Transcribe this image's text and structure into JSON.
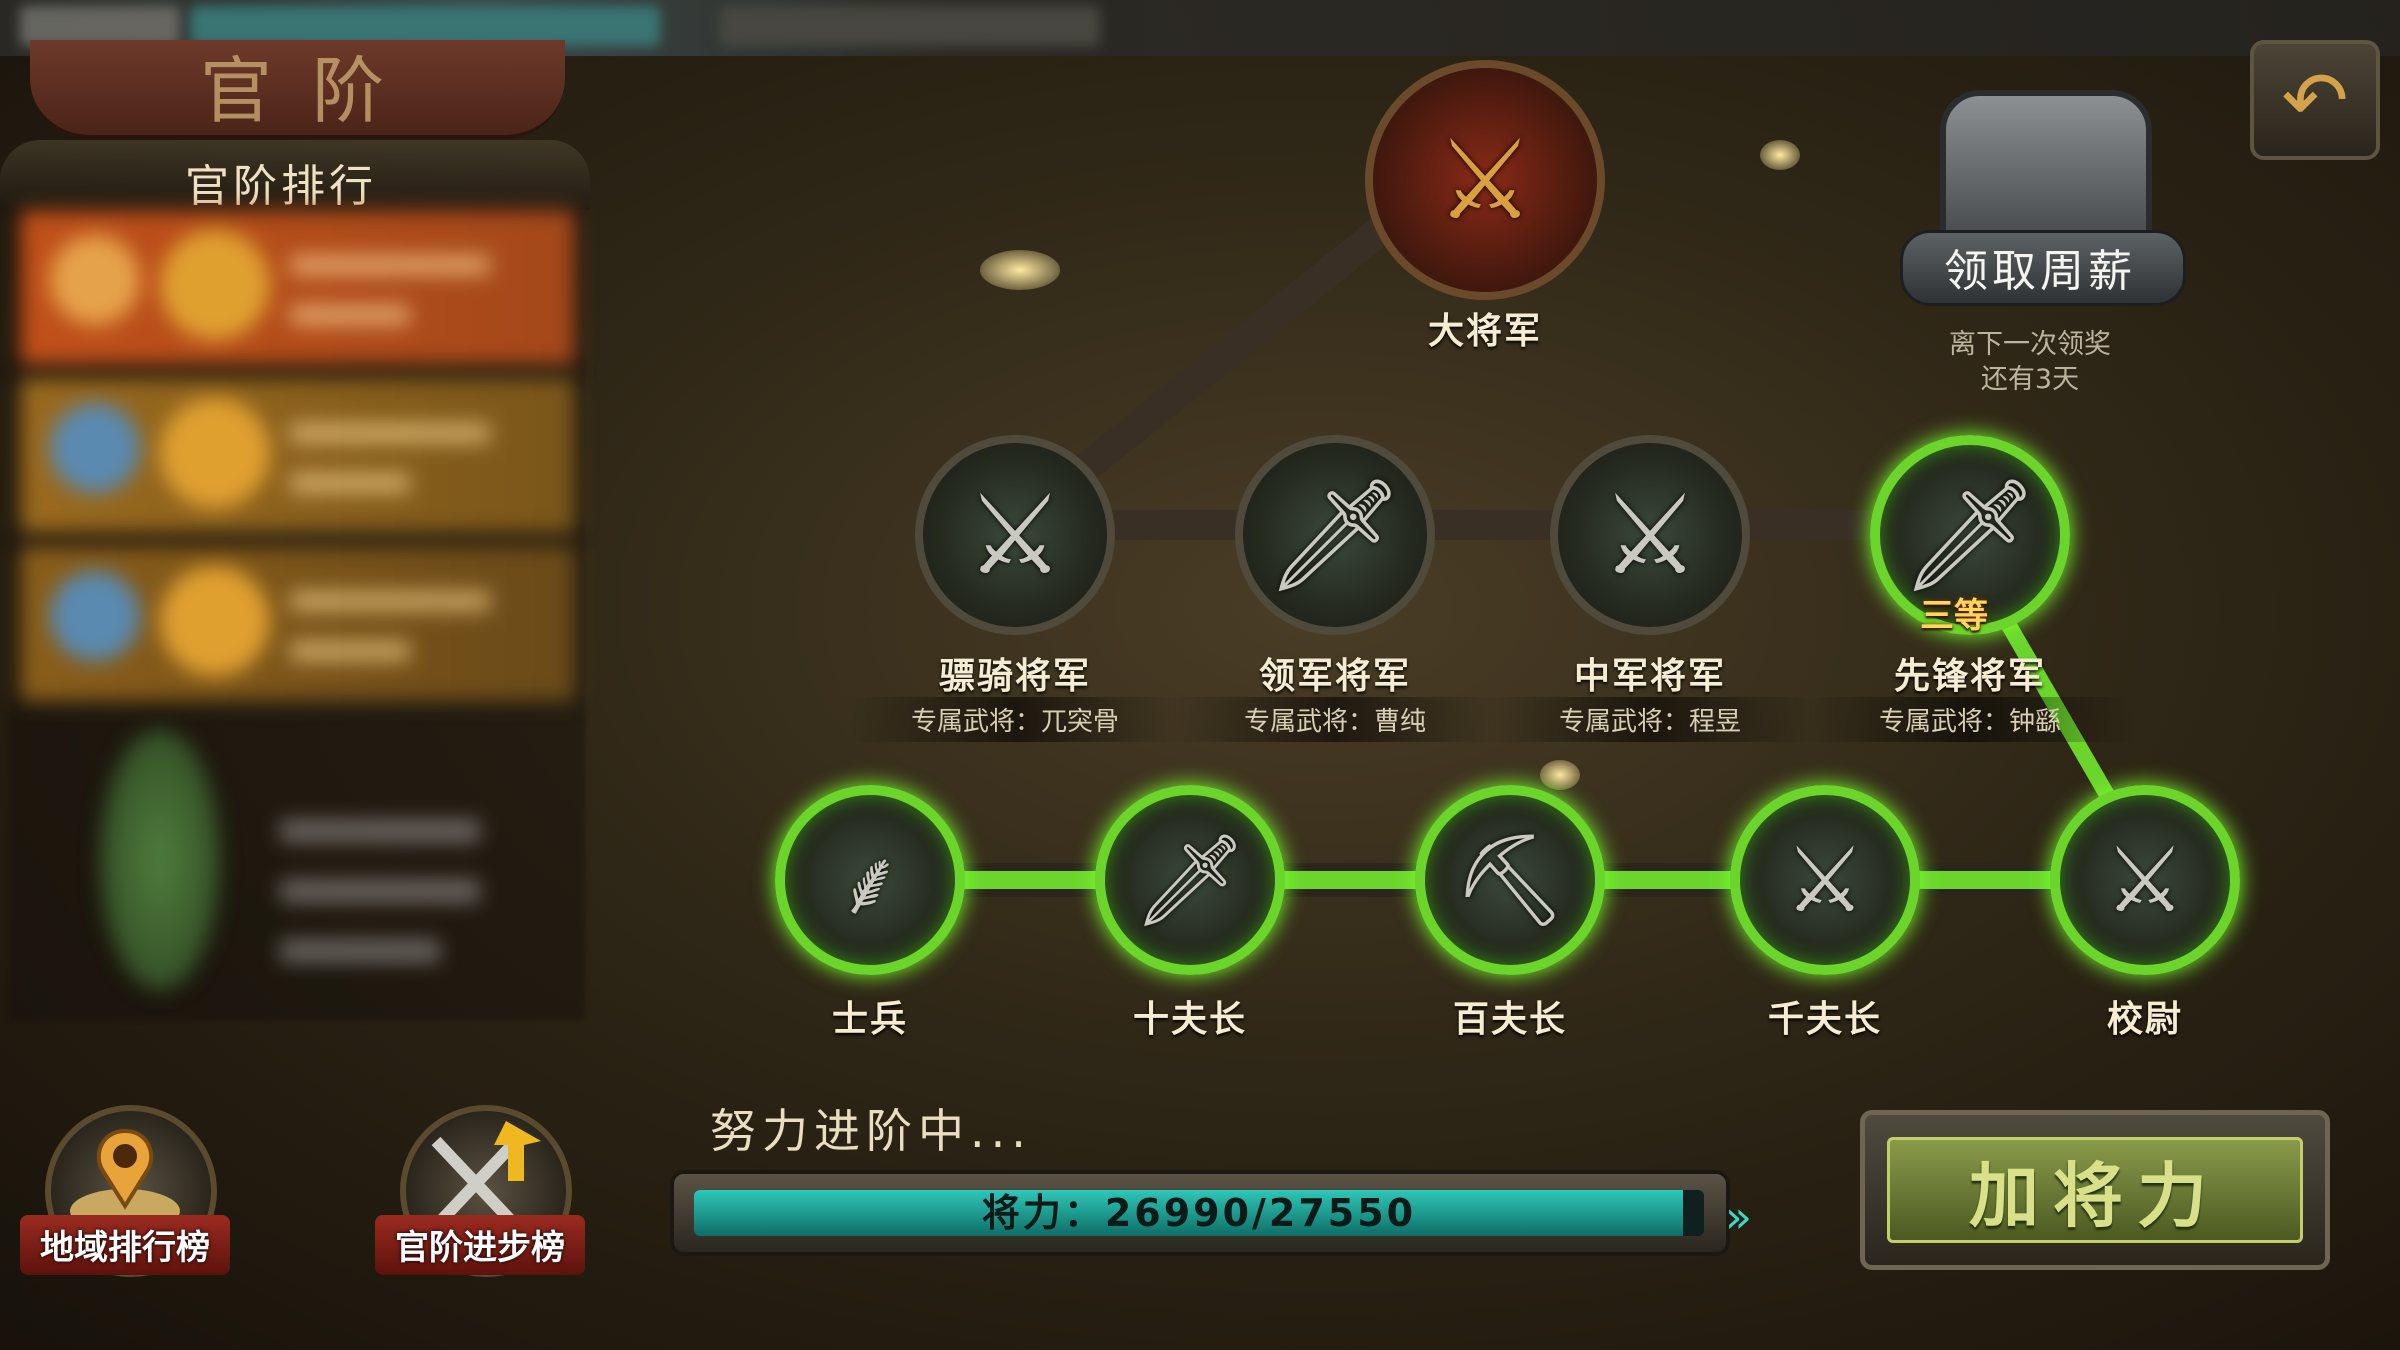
{
  "header": {
    "title": "官阶",
    "ranking_heading": "官阶排行"
  },
  "bottom_buttons": [
    {
      "label": "地域排行榜",
      "icon": "map-pin-icon"
    },
    {
      "label": "官阶进步榜",
      "icon": "crossed-swords-arrow-icon"
    }
  ],
  "top_node": {
    "label": "大将军",
    "icon": "axe-emblem-icon"
  },
  "general_nodes": [
    {
      "label": "骠骑将军",
      "sub": "专属武将：兀突骨"
    },
    {
      "label": "领军将军",
      "sub": "专属武将：曹纯"
    },
    {
      "label": "中军将军",
      "sub": "专属武将：程昱"
    },
    {
      "label": "先锋将军",
      "sub": "专属武将：钟繇",
      "grade": "三等"
    }
  ],
  "officer_nodes": [
    {
      "label": "士兵"
    },
    {
      "label": "十夫长"
    },
    {
      "label": "百夫长"
    },
    {
      "label": "千夫长"
    },
    {
      "label": "校尉"
    }
  ],
  "weekly_salary": {
    "label": "领取周薪",
    "line1": "离下一次领奖",
    "line2": "还有3天"
  },
  "progress": {
    "title": "努力进阶中...",
    "text": "将力：26990/27550",
    "current": 26990,
    "max": 27550
  },
  "add_button": {
    "label": "加将力"
  },
  "colors": {
    "active_green": "#6bd52c",
    "progress_teal": "#2ec8b8",
    "ribbon_red": "#9b2b20"
  }
}
